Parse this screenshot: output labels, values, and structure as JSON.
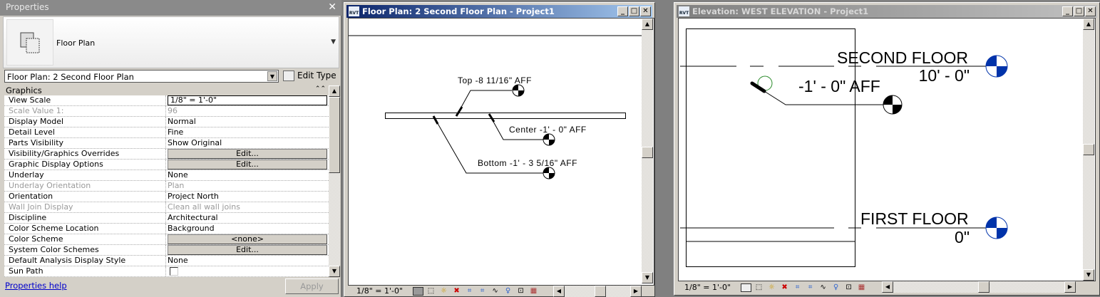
{
  "properties": {
    "title": "Properties",
    "type_name": "Floor Plan",
    "view_selector": "Floor Plan: 2 Second Floor Plan",
    "edit_type": "Edit Type",
    "group": "Graphics",
    "rows": [
      {
        "label": "View Scale",
        "value": "1/8\" = 1'-0\"",
        "kind": "scale"
      },
      {
        "label": "Scale Value    1:",
        "value": "96",
        "kind": "text",
        "disabled": true
      },
      {
        "label": "Display Model",
        "value": "Normal",
        "kind": "text"
      },
      {
        "label": "Detail Level",
        "value": "Fine",
        "kind": "text"
      },
      {
        "label": "Parts Visibility",
        "value": "Show Original",
        "kind": "text"
      },
      {
        "label": "Visibility/Graphics Overrides",
        "value": "Edit...",
        "kind": "button"
      },
      {
        "label": "Graphic Display Options",
        "value": "Edit...",
        "kind": "button"
      },
      {
        "label": "Underlay",
        "value": "None",
        "kind": "text"
      },
      {
        "label": "Underlay Orientation",
        "value": "Plan",
        "kind": "text",
        "disabled": true
      },
      {
        "label": "Orientation",
        "value": "Project North",
        "kind": "text"
      },
      {
        "label": "Wall Join Display",
        "value": "Clean all wall joins",
        "kind": "text",
        "disabled": true
      },
      {
        "label": "Discipline",
        "value": "Architectural",
        "kind": "text"
      },
      {
        "label": "Color Scheme Location",
        "value": "Background",
        "kind": "text"
      },
      {
        "label": "Color Scheme",
        "value": "<none>",
        "kind": "button"
      },
      {
        "label": "System Color Schemes",
        "value": "Edit...",
        "kind": "button"
      },
      {
        "label": "Default Analysis Display Style",
        "value": "None",
        "kind": "text"
      },
      {
        "label": "Sun Path",
        "value": "",
        "kind": "checkbox",
        "checked": false
      }
    ],
    "help_link": "Properties help",
    "apply": "Apply"
  },
  "floor_plan": {
    "title": "Floor Plan: 2 Second Floor Plan - Project1",
    "tags": {
      "top": "Top -8 11/16\" AFF",
      "center": "Center -1' - 0\" AFF",
      "bottom": "Bottom -1' - 3 5/16\" AFF"
    },
    "scale": "1/8\" = 1'-0\""
  },
  "elevation": {
    "title": "Elevation: WEST ELEVATION - Project1",
    "levels": [
      {
        "name": "SECOND FLOOR",
        "elevation": "10' - 0\""
      },
      {
        "name": "FIRST FLOOR",
        "elevation": "0\""
      }
    ],
    "spot_elevation": "-1' - 0\" AFF",
    "scale": "1/8\" = 1'-0\""
  },
  "colors": {
    "level_head": "#0033aa",
    "active_title": "#0a246a",
    "inactive_title": "#808080"
  }
}
